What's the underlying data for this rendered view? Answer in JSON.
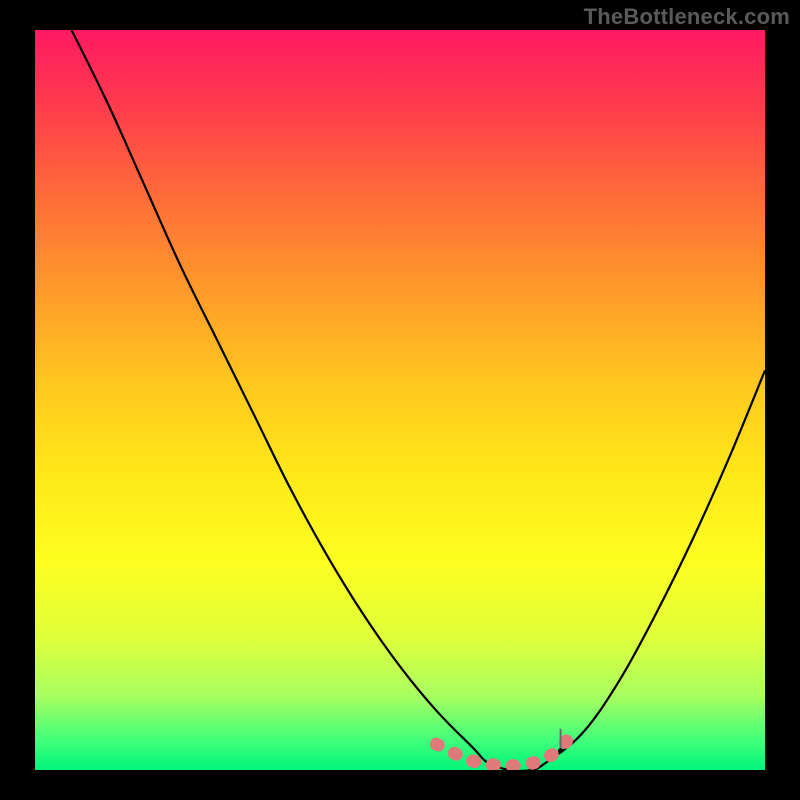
{
  "watermark": "TheBottleneck.com",
  "chart_data": {
    "type": "line",
    "title": "",
    "xlabel": "",
    "ylabel": "",
    "xlim": [
      0,
      100
    ],
    "ylim": [
      0,
      100
    ],
    "grid": false,
    "legend": false,
    "background_gradient": [
      "#ff1a63",
      "#ffe818",
      "#00f57a"
    ],
    "series": [
      {
        "name": "bottleneck-curve",
        "color": "#000000",
        "x": [
          5,
          10,
          15,
          20,
          25,
          30,
          35,
          40,
          45,
          50,
          55,
          60,
          62,
          65,
          68,
          70,
          75,
          80,
          85,
          90,
          95,
          100
        ],
        "y": [
          100,
          90,
          79,
          68,
          58,
          48,
          38,
          29,
          21,
          14,
          8,
          3,
          1,
          0,
          0,
          1,
          5,
          12,
          21,
          31,
          42,
          54
        ]
      },
      {
        "name": "ideal-zone",
        "color": "#e07a7a",
        "x": [
          55,
          58,
          60,
          62,
          64,
          66,
          68,
          70,
          72,
          74
        ],
        "y": [
          3.5,
          2,
          1.2,
          0.8,
          0.6,
          0.6,
          0.9,
          1.6,
          3,
          5.5
        ]
      }
    ],
    "annotations": [
      {
        "type": "vline",
        "x": 72,
        "color": "#6a6a6a",
        "style": "short"
      }
    ]
  },
  "axes": {
    "x_ticks_visible": false,
    "y_ticks_visible": false
  }
}
